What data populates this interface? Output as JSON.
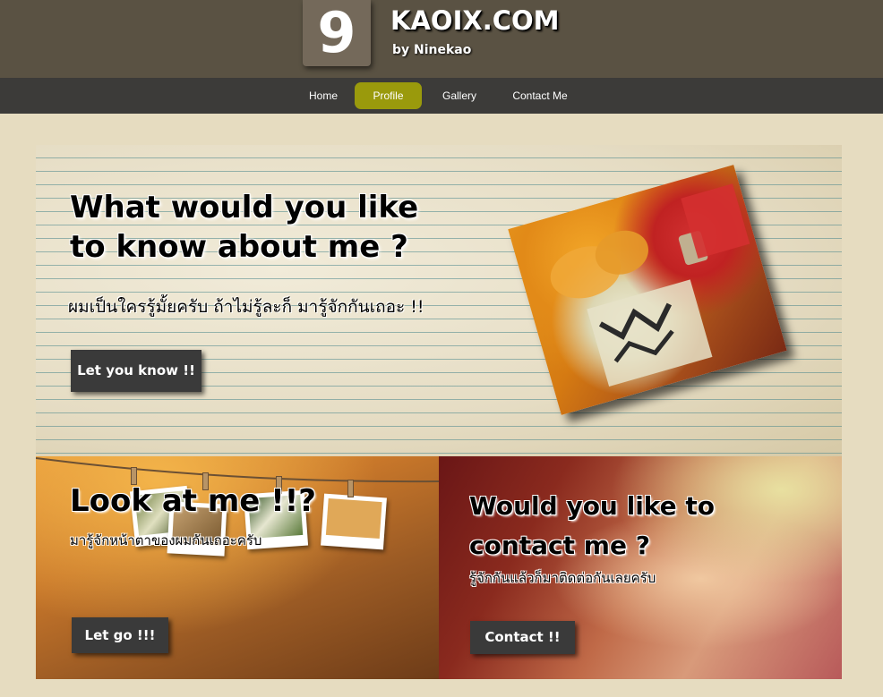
{
  "header": {
    "logo_digit": "9",
    "site_name": "KAOIX.COM",
    "site_sub": "by Ninekao"
  },
  "nav": {
    "items": [
      {
        "label": "Home"
      },
      {
        "label": "Profile",
        "active": true
      },
      {
        "label": "Gallery"
      },
      {
        "label": "Contact Me"
      }
    ],
    "active_color": "#9a9a0c"
  },
  "hero": {
    "title_line1": "What would you like",
    "title_line2": "to know about me ?",
    "subtitle": "ผมเป็นใครรู้มั้ยครับ ถ้าไม่รู้ละก็ มารู้จักกันเถอะ !!",
    "button": "Let you know !!",
    "photo": "profile-photo"
  },
  "gallery_panel": {
    "title": "Look at me !!?",
    "subtitle": "มารู้จักหน้าตาของผมกันเถอะครับ",
    "button": "Let go !!!"
  },
  "contact_panel": {
    "title_line1": "Would you like to",
    "title_line2": "contact me ?",
    "subtitle": "รู้จักกันแล้วก็มาติดต่อกันเลยครับ",
    "button": "Contact !!"
  },
  "colors": {
    "header_bg": "#5a5243",
    "nav_bg": "#3c3b39",
    "page_bg": "#e6dcc0",
    "button_bg": "#3a3a3a"
  }
}
